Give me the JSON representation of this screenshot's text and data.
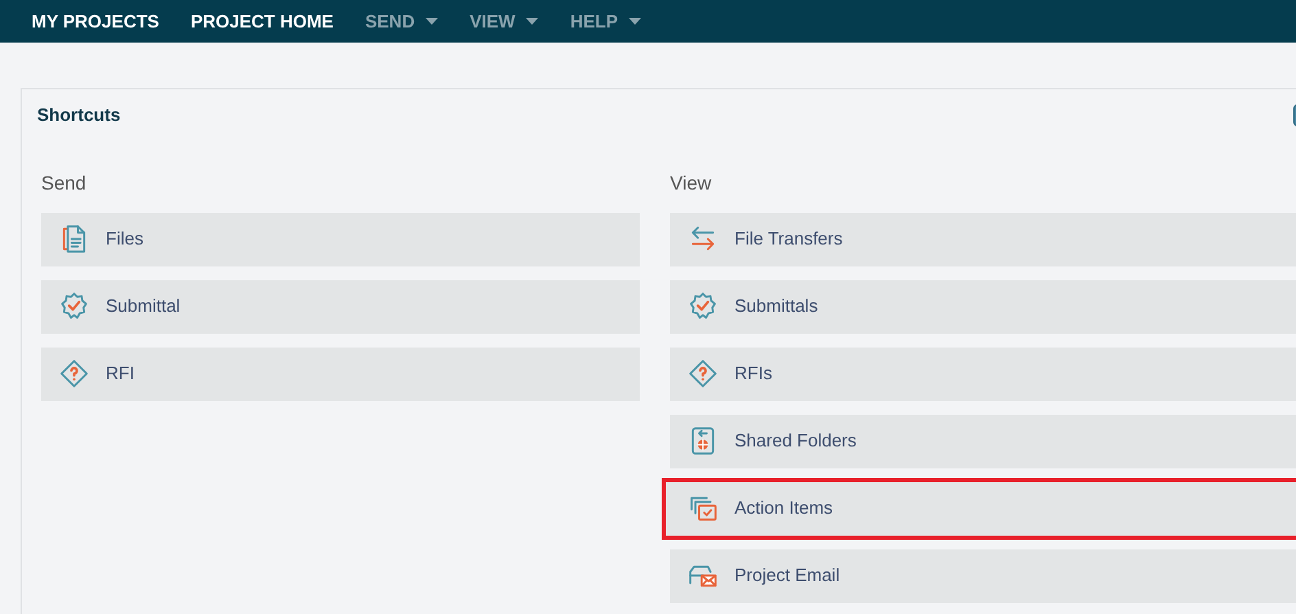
{
  "nav": [
    {
      "label": "MY PROJECTS",
      "dropdown": false
    },
    {
      "label": "PROJECT HOME",
      "dropdown": false
    },
    {
      "label": "SEND",
      "dropdown": true
    },
    {
      "label": "VIEW",
      "dropdown": true
    },
    {
      "label": "HELP",
      "dropdown": true
    }
  ],
  "panel": {
    "title": "Shortcuts",
    "columns": [
      {
        "heading": "Send",
        "items": [
          {
            "label": "Files",
            "kind": "files",
            "highlighted": false
          },
          {
            "label": "Submittal",
            "kind": "submittal",
            "highlighted": false
          },
          {
            "label": "RFI",
            "kind": "rfi",
            "highlighted": false
          }
        ]
      },
      {
        "heading": "View",
        "items": [
          {
            "label": "File Transfers",
            "kind": "transfers",
            "highlighted": false
          },
          {
            "label": "Submittals",
            "kind": "submittal",
            "highlighted": false
          },
          {
            "label": "RFIs",
            "kind": "rfi",
            "highlighted": false
          },
          {
            "label": "Shared Folders",
            "kind": "folders",
            "highlighted": false
          },
          {
            "label": "Action Items",
            "kind": "actions",
            "highlighted": true
          },
          {
            "label": "Project Email",
            "kind": "email",
            "highlighted": false
          }
        ]
      }
    ]
  }
}
